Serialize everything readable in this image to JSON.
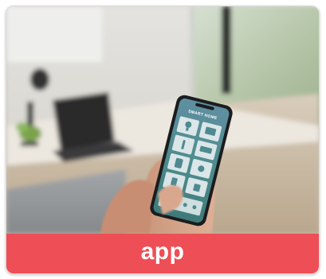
{
  "card": {
    "label": "app",
    "accent_color": "#ee4e56"
  },
  "photo": {
    "phone_screen_title": "SMART HOME",
    "icons": [
      "lightbulb-icon",
      "tv-icon",
      "thermostat-icon",
      "ac-icon",
      "speaker-icon",
      "camera-icon",
      "plug-icon",
      "lock-icon"
    ]
  }
}
